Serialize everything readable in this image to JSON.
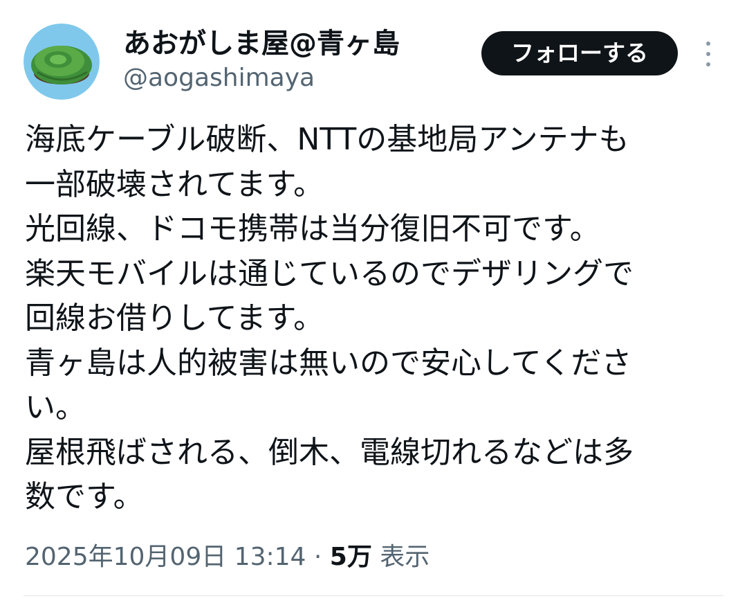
{
  "author": {
    "display_name": "あおがしま屋@青ヶ島",
    "handle": "@aogashimaya",
    "avatar_icon": "island-avatar-icon"
  },
  "actions": {
    "follow_label": "フォローする",
    "more_icon": "more-vertical-icon"
  },
  "tweet": {
    "lines": [
      "海底ケーブル破断、NTTの基地局アンテナも",
      "一部破壊されてます。",
      "光回線、ドコモ携帯は当分復旧不可です。",
      "楽天モバイルは通じているのでデザリングで",
      "回線お借りしてます。",
      "青ヶ島は人的被害は無いので安心してくださ",
      "い。",
      "屋根飛ばされる、倒木、電線切れるなどは多",
      "数です。"
    ]
  },
  "meta": {
    "timestamp": "2025年10月09日 13:14",
    "separator": " · ",
    "views_count": "5万",
    "views_label": " 表示"
  },
  "colors": {
    "text_primary": "#0f1419",
    "text_secondary": "#536471",
    "button_bg": "#0f1419",
    "button_text": "#ffffff"
  }
}
